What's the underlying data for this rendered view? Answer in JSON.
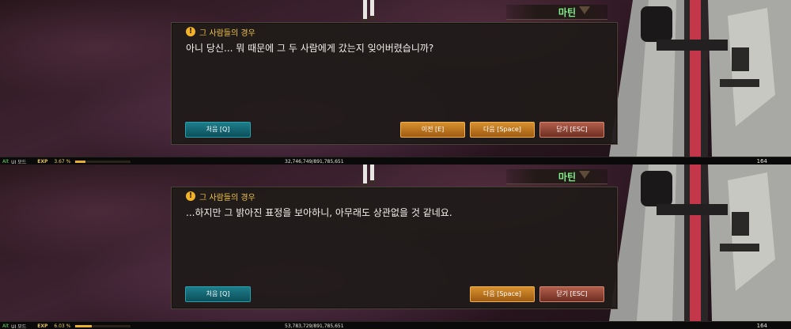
{
  "panels": [
    {
      "speaker_name": "마틴",
      "dialog_title": "그 사람들의 경우",
      "dialog_text": "아니 당신... 뭐 때문에 그 두 사람에게 갔는지 잊어버렸습니까?",
      "buttons": {
        "first": "처음 [Q]",
        "prev": "이전 [E]",
        "next": "다음 [Space]",
        "close": "닫기 [ESC]"
      },
      "status": {
        "alt_key": "Alt",
        "ui_mode": "UI 모드",
        "exp_label": "EXP",
        "exp_percent": "3.67 %",
        "exp_fraction": 0.0367,
        "exp_values": "32,746,749/891,785,651",
        "level": "164"
      }
    },
    {
      "speaker_name": "마틴",
      "dialog_title": "그 사람들의 경우",
      "dialog_text": "...하지만 그 밝아진 표정을 보아하니, 아무래도 상관없을 것 같네요.",
      "buttons": {
        "first": "처음 [Q]",
        "next": "다음 [Space]",
        "close": "닫기 [ESC]"
      },
      "status": {
        "alt_key": "Alt",
        "ui_mode": "UI 모드",
        "exp_label": "EXP",
        "exp_percent": "6.03 %",
        "exp_fraction": 0.0603,
        "exp_values": "53,783,729/891,785,651",
        "level": "164"
      }
    }
  ],
  "icons": {
    "title_icon": "exclamation-icon"
  },
  "colors": {
    "speaker_name": "#7ff08a",
    "dialog_title": "#f0c34a",
    "exp_fill": "#e8b030",
    "button_first": "#1e7d8a",
    "button_orange": "#d8902e",
    "button_close": "#b25e4a"
  }
}
